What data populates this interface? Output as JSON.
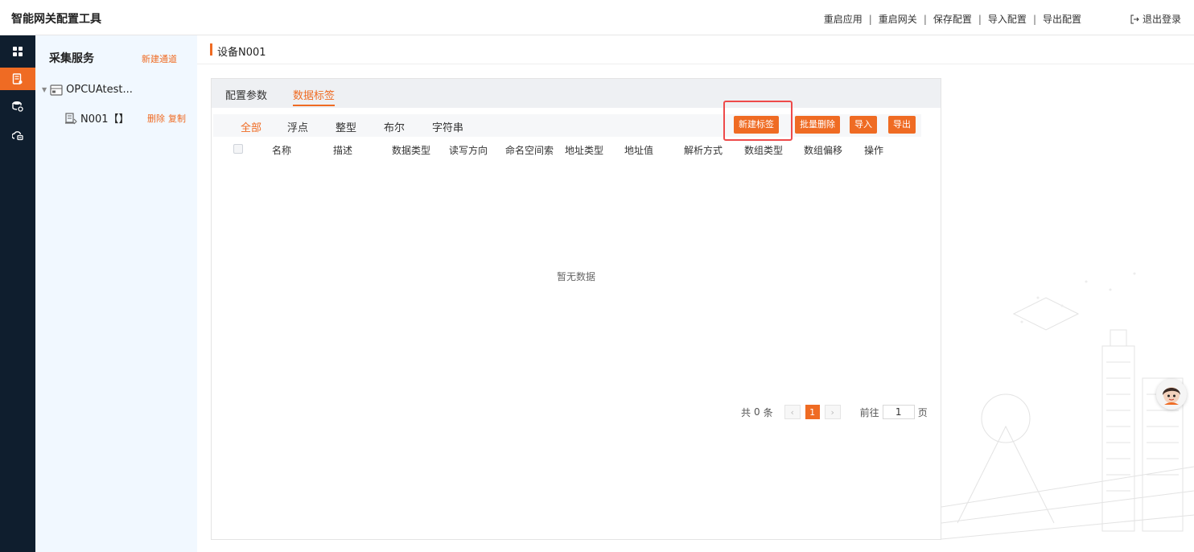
{
  "header": {
    "title": "智能网关配置工具",
    "actions": [
      "重启应用",
      "重启网关",
      "保存配置",
      "导入配置",
      "导出配置"
    ],
    "separator": "|",
    "logout": "退出登录"
  },
  "rail": {
    "icons": [
      "grid-icon",
      "device-list-icon",
      "database-settings-icon",
      "cloud-lock-icon"
    ],
    "active_index": 1
  },
  "tree": {
    "title": "采集服务",
    "new_channel": "新建通道",
    "channel_label": "OPCUAtest...",
    "device_label": "N001【】",
    "delete": "删除",
    "copy": "复制"
  },
  "main": {
    "title": "设备N001",
    "tabs": [
      "配置参数",
      "数据标签"
    ],
    "active_tab": "数据标签",
    "filters": [
      "全部",
      "浮点",
      "整型",
      "布尔",
      "字符串"
    ],
    "active_filter": "全部",
    "buttons": {
      "new_tag": "新建标签",
      "batch_delete": "批量删除",
      "import": "导入",
      "export": "导出"
    },
    "columns": [
      "名称",
      "描述",
      "数据类型",
      "读写方向",
      "命名空间索",
      "地址类型",
      "地址值",
      "解析方式",
      "数组类型",
      "数组偏移",
      "操作"
    ],
    "empty_text": "暂无数据",
    "pagination": {
      "total_prefix": "共",
      "total": "0",
      "total_suffix": "条",
      "current_page": "1",
      "goto_label": "前往",
      "goto_value": "1",
      "page_suffix": "页"
    }
  },
  "colors": {
    "accent": "#ef6b23",
    "rail_bg": "#0f1e2e",
    "tree_bg": "#f1f8ff",
    "highlight": "#ee4a4a"
  }
}
